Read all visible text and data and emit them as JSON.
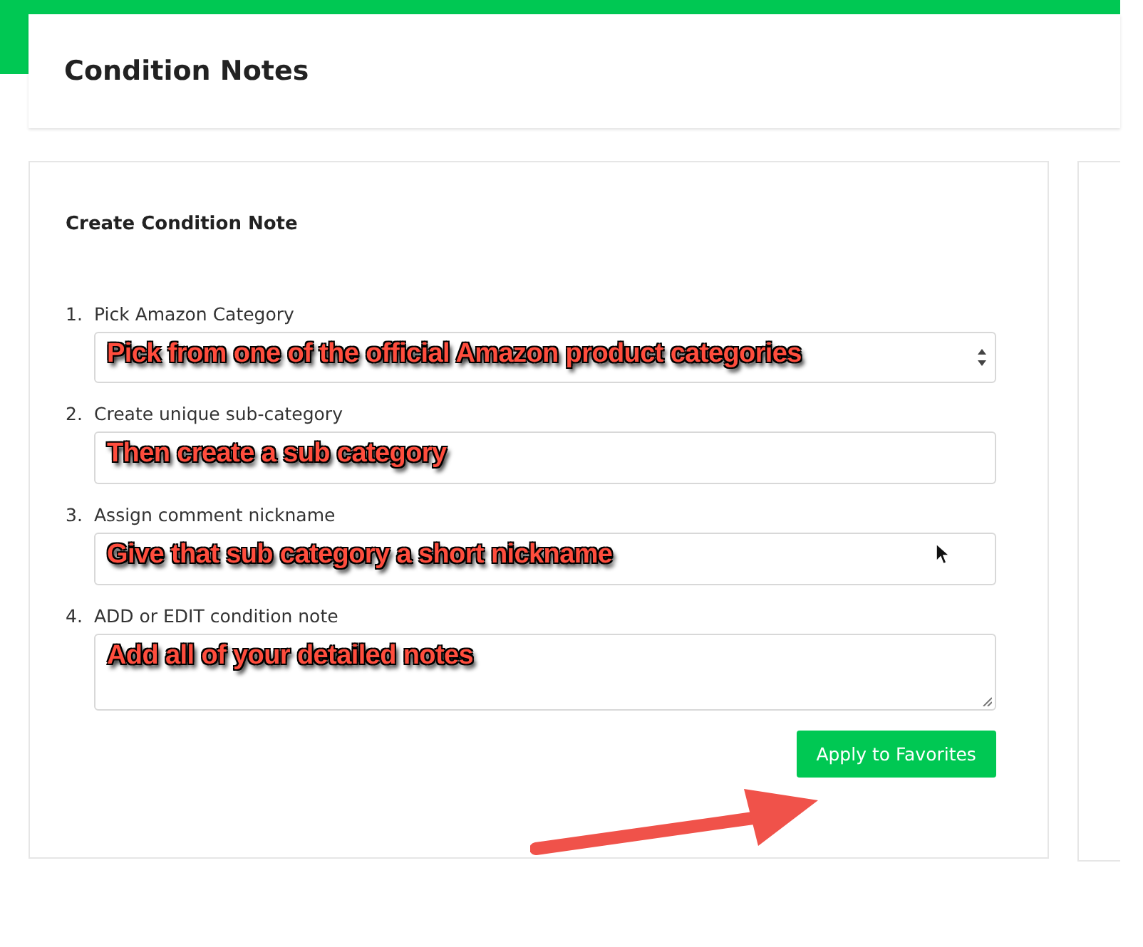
{
  "header": {
    "title": "Condition Notes"
  },
  "form": {
    "title": "Create Condition Note",
    "steps": [
      {
        "number": "1.",
        "label": "Pick Amazon Category",
        "kind": "select",
        "annotation": "Pick from one of the official Amazon product categories"
      },
      {
        "number": "2.",
        "label": "Create unique sub-category",
        "kind": "input",
        "annotation": "Then create a sub category"
      },
      {
        "number": "3.",
        "label": "Assign comment nickname",
        "kind": "input",
        "annotation": "Give that sub category a short nickname"
      },
      {
        "number": "4.",
        "label": "ADD or EDIT condition note",
        "kind": "textarea",
        "annotation": "Add all of your detailed notes"
      }
    ],
    "button": "Apply to Favorites"
  }
}
